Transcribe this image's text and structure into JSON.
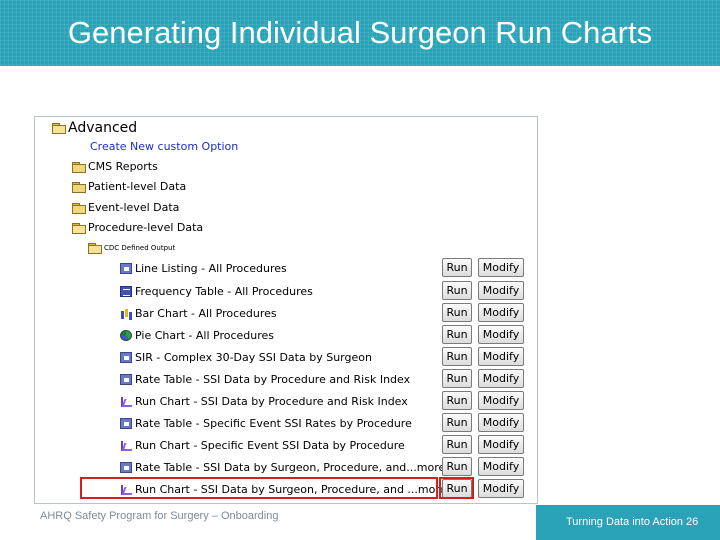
{
  "slide": {
    "title": "Generating Individual Surgeon Run Charts",
    "footer_left": "AHRQ Safety Program for Surgery – Onboarding",
    "footer_right": "Turning Data into Action",
    "page_number": "26"
  },
  "tree": {
    "root_label": "Advanced",
    "create_link": "Create New custom Option",
    "folders": [
      "CMS Reports",
      "Patient-level Data",
      "Event-level Data",
      "Procedure-level Data"
    ],
    "subfolder": "CDC Defined Output"
  },
  "buttons": {
    "run": "Run",
    "modify": "Modify"
  },
  "outputs": [
    {
      "label": "Line Listing - All Procedures",
      "icon": "list-icon"
    },
    {
      "label": "Frequency Table - All Procedures",
      "icon": "frequency-table-icon"
    },
    {
      "label": "Bar Chart - All Procedures",
      "icon": "bar-chart-icon"
    },
    {
      "label": "Pie Chart - All Procedures",
      "icon": "pie-chart-icon"
    },
    {
      "label": "SIR - Complex 30-Day SSI Data by Surgeon",
      "icon": "list-icon"
    },
    {
      "label": "Rate Table - SSI Data by Procedure and Risk Index",
      "icon": "list-icon"
    },
    {
      "label": "Run Chart - SSI Data by Procedure and Risk Index",
      "icon": "run-chart-icon"
    },
    {
      "label": "Rate Table - Specific Event SSI Rates by Procedure",
      "icon": "list-icon"
    },
    {
      "label": "Run Chart - Specific Event SSI Data by Procedure",
      "icon": "run-chart-icon"
    },
    {
      "label": "Rate Table - SSI Data by Surgeon, Procedure, and...more",
      "icon": "list-icon"
    },
    {
      "label": "Run Chart - SSI Data by Surgeon, Procedure, and ...more",
      "icon": "run-chart-icon"
    }
  ],
  "colors": {
    "header": "#2aa3b9",
    "highlight": "#d0201f",
    "link": "#1a2fbf"
  }
}
